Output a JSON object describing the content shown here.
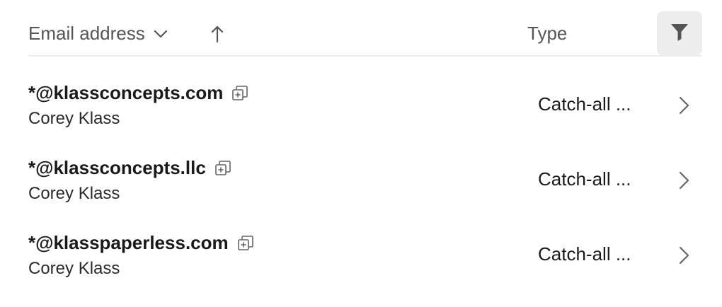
{
  "header": {
    "email_label": "Email address",
    "type_label": "Type",
    "sort_icon": "arrow-up-icon",
    "dropdown_icon": "chevron-down-icon",
    "filter_icon": "filter-icon"
  },
  "rows": [
    {
      "email": "*@klassconcepts.com",
      "owner": "Corey Klass",
      "type": "Catch-all ..."
    },
    {
      "email": "*@klassconcepts.llc",
      "owner": "Corey Klass",
      "type": "Catch-all ..."
    },
    {
      "email": "*@klasspaperless.com",
      "owner": "Corey Klass",
      "type": "Catch-all ..."
    }
  ],
  "colors": {
    "header_text": "#555555",
    "divider": "#ececec",
    "filter_bg": "#ededed",
    "text": "#1a1a1a"
  }
}
